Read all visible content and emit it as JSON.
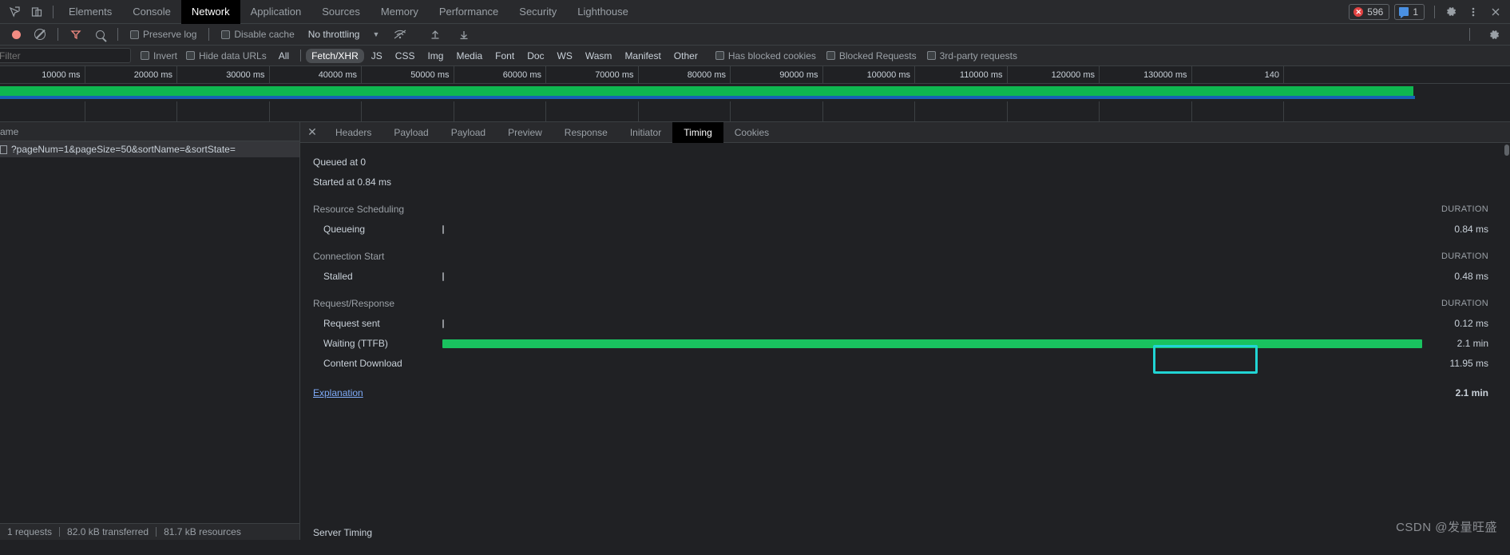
{
  "devtools": {
    "icons": {
      "inspect": "inspect-element-icon",
      "device": "device-toolbar-icon"
    },
    "tabs": [
      {
        "label": "Elements",
        "active": false
      },
      {
        "label": "Console",
        "active": false
      },
      {
        "label": "Network",
        "active": true
      },
      {
        "label": "Application",
        "active": false
      },
      {
        "label": "Sources",
        "active": false
      },
      {
        "label": "Memory",
        "active": false
      },
      {
        "label": "Performance",
        "active": false
      },
      {
        "label": "Security",
        "active": false
      },
      {
        "label": "Lighthouse",
        "active": false
      }
    ],
    "status": {
      "error_count": "596",
      "message_count": "1",
      "error_color": "#e34343",
      "message_color": "#4a90e2"
    },
    "settings_label": "gear-icon",
    "more_label": "more-options-icon",
    "close_label": "close-icon"
  },
  "network_toolbar": {
    "record_label": "record-button",
    "clear_label": "clear-button",
    "filter_label": "filter-toggle",
    "search_label": "search-button",
    "preserve_log": "Preserve log",
    "disable_cache": "Disable cache",
    "throttling": "No throttling",
    "import_label": "import-har-icon",
    "export_label": "export-har-icon",
    "wifi_label": "network-conditions-icon",
    "settings_label": "network-settings-icon"
  },
  "filter_bar": {
    "placeholder": "Filter",
    "invert": "Invert",
    "hide_data_urls": "Hide data URLs",
    "types": [
      {
        "label": "All",
        "active": false
      },
      {
        "label": "Fetch/XHR",
        "active": true
      },
      {
        "label": "JS",
        "active": false
      },
      {
        "label": "CSS",
        "active": false
      },
      {
        "label": "Img",
        "active": false
      },
      {
        "label": "Media",
        "active": false
      },
      {
        "label": "Font",
        "active": false
      },
      {
        "label": "Doc",
        "active": false
      },
      {
        "label": "WS",
        "active": false
      },
      {
        "label": "Wasm",
        "active": false
      },
      {
        "label": "Manifest",
        "active": false
      },
      {
        "label": "Other",
        "active": false
      }
    ],
    "has_blocked_cookies": "Has blocked cookies",
    "blocked_requests": "Blocked Requests",
    "third_party": "3rd-party requests"
  },
  "timeline": {
    "ticks": [
      "10000 ms",
      "20000 ms",
      "30000 ms",
      "40000 ms",
      "50000 ms",
      "60000 ms",
      "70000 ms",
      "80000 ms",
      "90000 ms",
      "100000 ms",
      "110000 ms",
      "120000 ms",
      "130000 ms",
      "140"
    ],
    "bar_color": "#0fb750",
    "line_color": "#1763b4"
  },
  "requests_pane": {
    "column_header": "ame",
    "rows": [
      {
        "name": "?pageNum=1&pageSize=50&sortName=&sortState="
      }
    ],
    "footer": {
      "requests": "1 requests",
      "transferred": "82.0 kB transferred",
      "resources": "81.7 kB resources"
    }
  },
  "detail_pane": {
    "tabs": [
      {
        "label": "Headers",
        "active": false
      },
      {
        "label": "Payload",
        "active": false
      },
      {
        "label": "Payload",
        "active": false
      },
      {
        "label": "Preview",
        "active": false
      },
      {
        "label": "Response",
        "active": false
      },
      {
        "label": "Initiator",
        "active": false
      },
      {
        "label": "Timing",
        "active": true
      },
      {
        "label": "Cookies",
        "active": false
      }
    ],
    "timing": {
      "queued_at": "Queued at 0",
      "started_at": "Started at 0.84 ms",
      "duration_header": "DURATION",
      "sections": [
        {
          "title": "Resource Scheduling",
          "rows": [
            {
              "label": "Queueing",
              "value": "0.84 ms",
              "bar": "thin",
              "highlight": false
            }
          ]
        },
        {
          "title": "Connection Start",
          "rows": [
            {
              "label": "Stalled",
              "value": "0.48 ms",
              "bar": "thin",
              "highlight": false
            }
          ]
        },
        {
          "title": "Request/Response",
          "rows": [
            {
              "label": "Request sent",
              "value": "0.12 ms",
              "bar": "thin",
              "highlight": false
            },
            {
              "label": "Waiting (TTFB)",
              "value": "2.1 min",
              "bar": "green",
              "highlight": true
            },
            {
              "label": "Content Download",
              "value": "11.95 ms",
              "bar": "thin",
              "highlight": false
            }
          ]
        }
      ],
      "explanation": "Explanation",
      "total": "2.1 min",
      "server_timing": "Server Timing",
      "highlight_color": "#21d4d4"
    }
  },
  "watermark": "CSDN @发量旺盛"
}
